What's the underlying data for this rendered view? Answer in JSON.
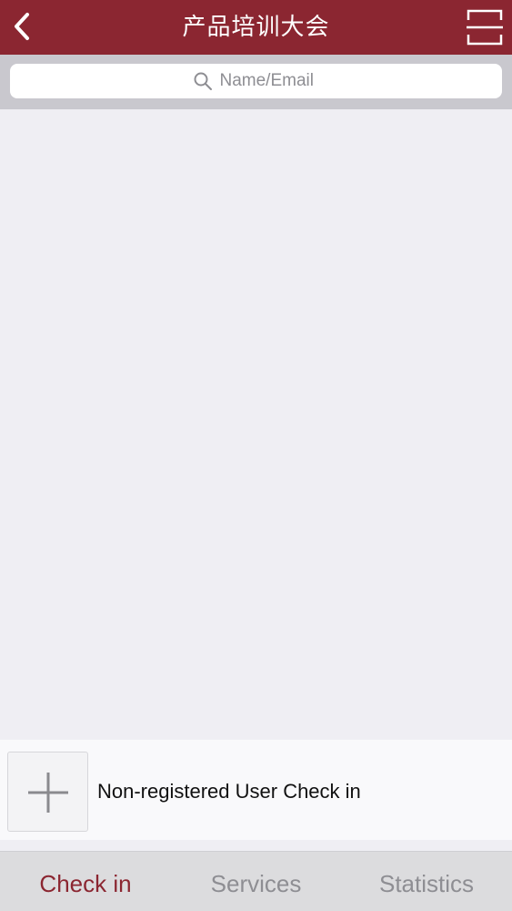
{
  "navbar": {
    "title": "产品培训大会",
    "back_icon": "chevron-left-icon",
    "scan_icon": "scan-icon"
  },
  "search": {
    "placeholder": "Name/Email",
    "icon": "search-icon"
  },
  "nonregistered": {
    "label": "Non-registered User Check in",
    "icon": "plus-icon"
  },
  "tabs": [
    {
      "label": "Check in",
      "active": true
    },
    {
      "label": "Services",
      "active": false
    },
    {
      "label": "Statistics",
      "active": false
    }
  ],
  "colors": {
    "brand": "#8b2631",
    "background": "#efeef3",
    "inactive_tab": "#8e8e93"
  }
}
